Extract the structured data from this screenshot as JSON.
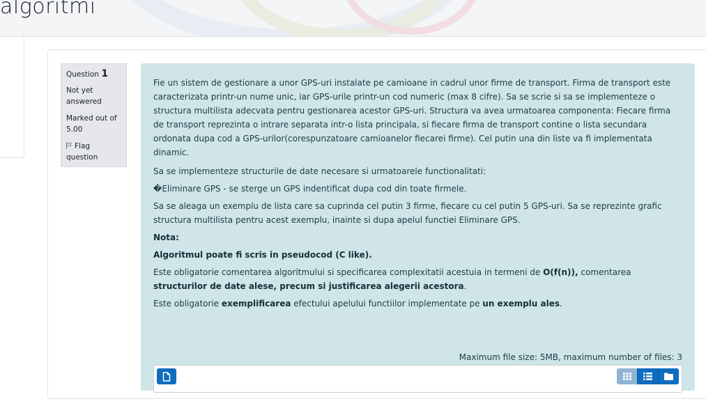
{
  "page": {
    "title": "algoritmi"
  },
  "question_info": {
    "label": "Question",
    "number": "1",
    "state": "Not yet answered",
    "grade": "Marked out of 5.00",
    "flag_label": "Flag question"
  },
  "question_text": {
    "p1": "Fie un sistem de gestionare a unor GPS-uri instalate pe camioane in cadrul unor firme de transport. Firma de transport este caracterizata printr-un nume unic, iar GPS-urile printr-un cod numeric (max 8 cifre). Sa se scrie si sa se implementeze o structura multilista adecvata pentru gestionarea acestor GPS-uri. Structura va avea urmatoarea componenta: Fiecare firma de transport reprezinta o intrare separata intr-o lista principala, si fiecare firma de transport contine o lista secundara ordonata dupa cod a GPS-urilor(corespunzatoare camioanelor fiecarei firme). Cel putin una din liste va fi implementata dinamic.",
    "p2": "Sa se implementeze structurile de date necesare si urmatoarele functionalitati:",
    "p3": "Eliminare GPS - se sterge un GPS indentificat dupa cod din toate firmele.",
    "p4": "Sa se aleaga un exemplu de lista care sa cuprinda cel putin 3 firme, fiecare cu cel putin 5 GPS-uri. Sa se reprezinte grafic structura multilista pentru acest exemplu, inainte si dupa apelul functiei Eliminare GPS.",
    "nota": "Nota:",
    "algo": "Algoritmul poate fi scris in pseudocod (C like).",
    "p5_a": "Este obligatorie comentarea algoritmului si specificarea complexitatii acestuia in termeni de ",
    "p5_b": "O(f(n)),",
    "p5_c": " comentarea ",
    "p5_d": "structurilor de date alese, precum si justificarea alegerii acestora",
    "p5_e": ".",
    "p6_a": "Este obligatorie ",
    "p6_b": "exemplificarea",
    "p6_c": " efectului apelului functiilor implementate pe ",
    "p6_d": "un exemplu ales",
    "p6_e": "."
  },
  "file_picker": {
    "max_size_text": "Maximum file size: 5MB, maximum number of files: 3",
    "add_icon": "file-icon",
    "views": [
      "grid-view-icon",
      "list-view-icon",
      "folder-view-icon"
    ]
  },
  "colors": {
    "accent": "#0f6cbf",
    "question_bg": "#cfe5e8",
    "info_bg": "#e5e7ea"
  }
}
